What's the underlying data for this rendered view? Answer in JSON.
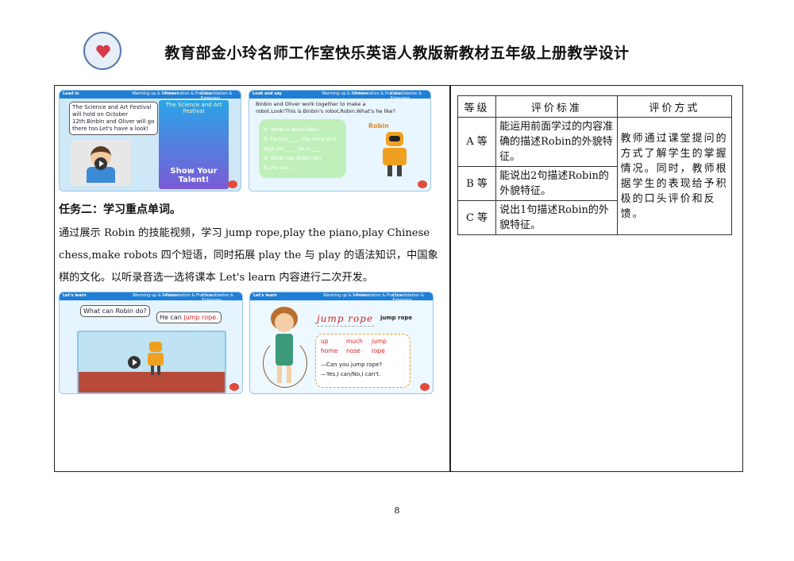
{
  "header": {
    "title": "教育部金小玲名师工作室快乐英语人教版新教材五年级上册教学设计"
  },
  "left": {
    "task_title": "任务二：学习重点单词。",
    "paragraph": "通过展示 Robin 的技能视频，学习 jump rope,play the piano,play Chinese chess,make robots 四个短语，同时拓展 play the 与 play 的语法知识，中国象棋的文化。以听录音选一选将课本 Let's learn 内容进行二次开发。",
    "slides": [
      {
        "section": "Lead in",
        "nav": [
          "Warming up & Revision",
          "Presentation & Practice",
          "Consolidation & Extension"
        ],
        "bubble": "The Science and Art Festival will hold on October 12th.Binbin and Oliver will go there too.Let's have a look!",
        "poster_title": "The Science and Art Festival",
        "poster_text": "Show Your Talent!"
      },
      {
        "section": "Look and say",
        "nav": [
          "Warming up & Revision",
          "Presentation & Practice",
          "Consolidation & Extension"
        ],
        "text": "Binbin and Oliver work together to make a robot.Look!This is Binbin's robot,Robin.What's he like?",
        "card_lines": [
          "A: What is Robin like?",
          "B: He has____. His arms and",
          "legs are____. He is____.",
          "A: What can Robin do?",
          "B: He can..."
        ],
        "robot_label": "Robin"
      },
      {
        "section": "Let's learn",
        "nav": [
          "Warming up & Revision",
          "Presentation & Practice",
          "Consolidation & Extension"
        ],
        "question": "What can Robin do?",
        "answer_prefix": "He can ",
        "answer_highlight": "jump rope."
      },
      {
        "section": "Let's learn",
        "nav": [
          "Warming up & Revision",
          "Presentation & Practice",
          "Consolidation & Extension"
        ],
        "word": "jump rope",
        "dict_label": "jump rope",
        "phonics_top": [
          "up",
          "much",
          "jump"
        ],
        "phonics_bottom": [
          "home",
          "nose",
          "rope"
        ],
        "dialog": [
          "—Can you jump rope?",
          "—Yes,I can/No,I can't."
        ]
      }
    ]
  },
  "table": {
    "headers": [
      "等级",
      "评价标准",
      "评价方式"
    ],
    "rows": [
      {
        "grade": "A 等",
        "criteria": "能运用前面学过的内容准确的描述Robin的外貌特征。"
      },
      {
        "grade": "B 等",
        "criteria": "能说出2句描述Robin的外貌特征。"
      },
      {
        "grade": "C 等",
        "criteria": "说出1句描述Robin的外貌特征。"
      }
    ],
    "method": "教师通过课堂提问的方式了解学生的掌握情况。同时，教师根据学生的表现给予积极的口头评价和反馈。"
  },
  "footer": {
    "page_number": "8"
  },
  "colors": {
    "slide_bar": "#1f7fd6",
    "nav_highlight": "#9bd36b",
    "phonics_red": "#d8232a"
  }
}
